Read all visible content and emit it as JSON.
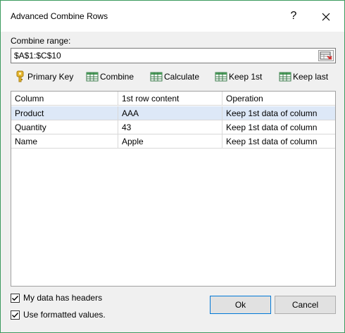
{
  "window": {
    "title": "Advanced Combine Rows",
    "help_label": "?",
    "close_icon": "close-icon"
  },
  "range": {
    "label": "Combine range:",
    "value": "$A$1:$C$10"
  },
  "toolbar": {
    "primary_key": "Primary Key",
    "combine": "Combine",
    "calculate": "Calculate",
    "keep_first": "Keep 1st",
    "keep_last": "Keep last"
  },
  "grid": {
    "columns": [
      "Column",
      "1st row content",
      "Operation"
    ],
    "rows": [
      {
        "column": "Product",
        "content": "AAA",
        "operation": "Keep 1st data of column",
        "selected": true
      },
      {
        "column": "Quantity",
        "content": "43",
        "operation": "Keep 1st data of column",
        "selected": false
      },
      {
        "column": "Name",
        "content": "Apple",
        "operation": "Keep 1st data of column",
        "selected": false
      }
    ]
  },
  "options": {
    "has_headers_label": "My data has headers",
    "has_headers_checked": true,
    "formatted_label": "Use formatted values.",
    "formatted_checked": true
  },
  "buttons": {
    "ok": "Ok",
    "cancel": "Cancel"
  },
  "colors": {
    "selection": "#dde8f7",
    "ok_border": "#0078d7",
    "frame": "#3c9a5f"
  }
}
